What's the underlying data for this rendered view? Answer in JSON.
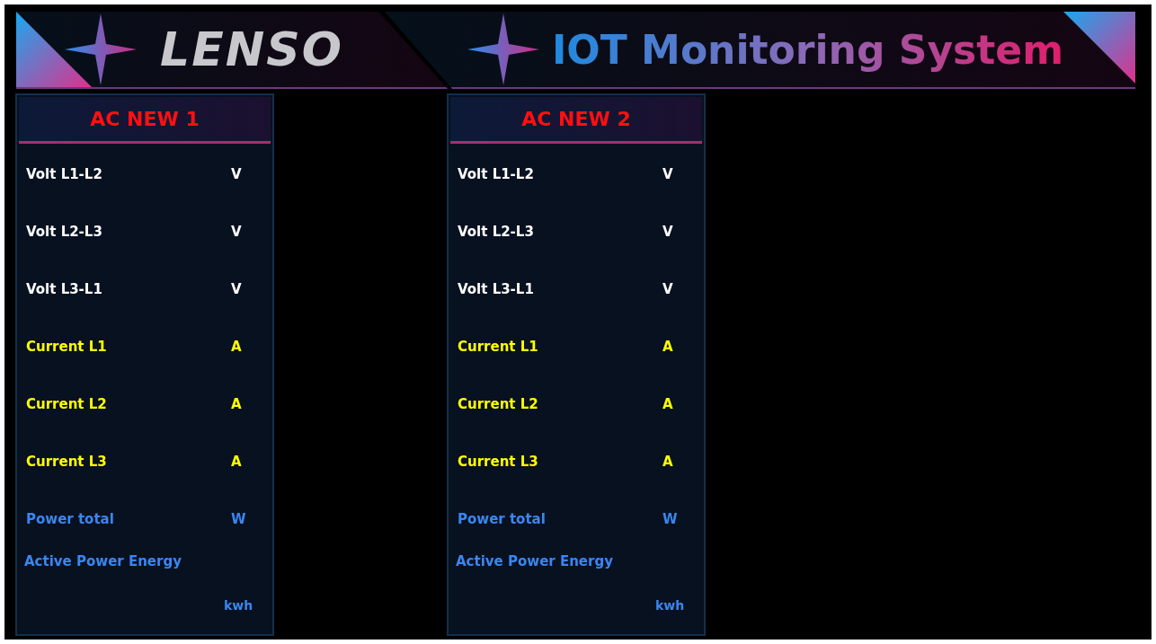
{
  "header": {
    "logo": "LENSO",
    "title": "IOT Monitoring System"
  },
  "panels": [
    {
      "title": "AC NEW 1",
      "rows": [
        {
          "kind": "volt",
          "label": "Volt L1-L2",
          "unit": "V"
        },
        {
          "kind": "volt",
          "label": "Volt L2-L3",
          "unit": "V"
        },
        {
          "kind": "volt",
          "label": "Volt L3-L1",
          "unit": "V"
        },
        {
          "kind": "current",
          "label": "Current L1",
          "unit": "A"
        },
        {
          "kind": "current",
          "label": "Current L2",
          "unit": "A"
        },
        {
          "kind": "current",
          "label": "Current  L3",
          "unit": "A"
        },
        {
          "kind": "power",
          "label": "Power total",
          "unit": "W"
        },
        {
          "kind": "energy",
          "label": "Active Power Energy",
          "unit": "kwh"
        }
      ]
    },
    {
      "title": "AC NEW 2",
      "rows": [
        {
          "kind": "volt",
          "label": "Volt L1-L2",
          "unit": "V"
        },
        {
          "kind": "volt",
          "label": "Volt L2-L3",
          "unit": "V"
        },
        {
          "kind": "volt",
          "label": "Volt L3-L1",
          "unit": "V"
        },
        {
          "kind": "current",
          "label": "Current L1",
          "unit": "A"
        },
        {
          "kind": "current",
          "label": "Current L2",
          "unit": "A"
        },
        {
          "kind": "current",
          "label": "Current  L3",
          "unit": "A"
        },
        {
          "kind": "power",
          "label": "Power total",
          "unit": "W"
        },
        {
          "kind": "energy",
          "label": "Active Power Energy",
          "unit": "kwh"
        }
      ]
    }
  ]
}
